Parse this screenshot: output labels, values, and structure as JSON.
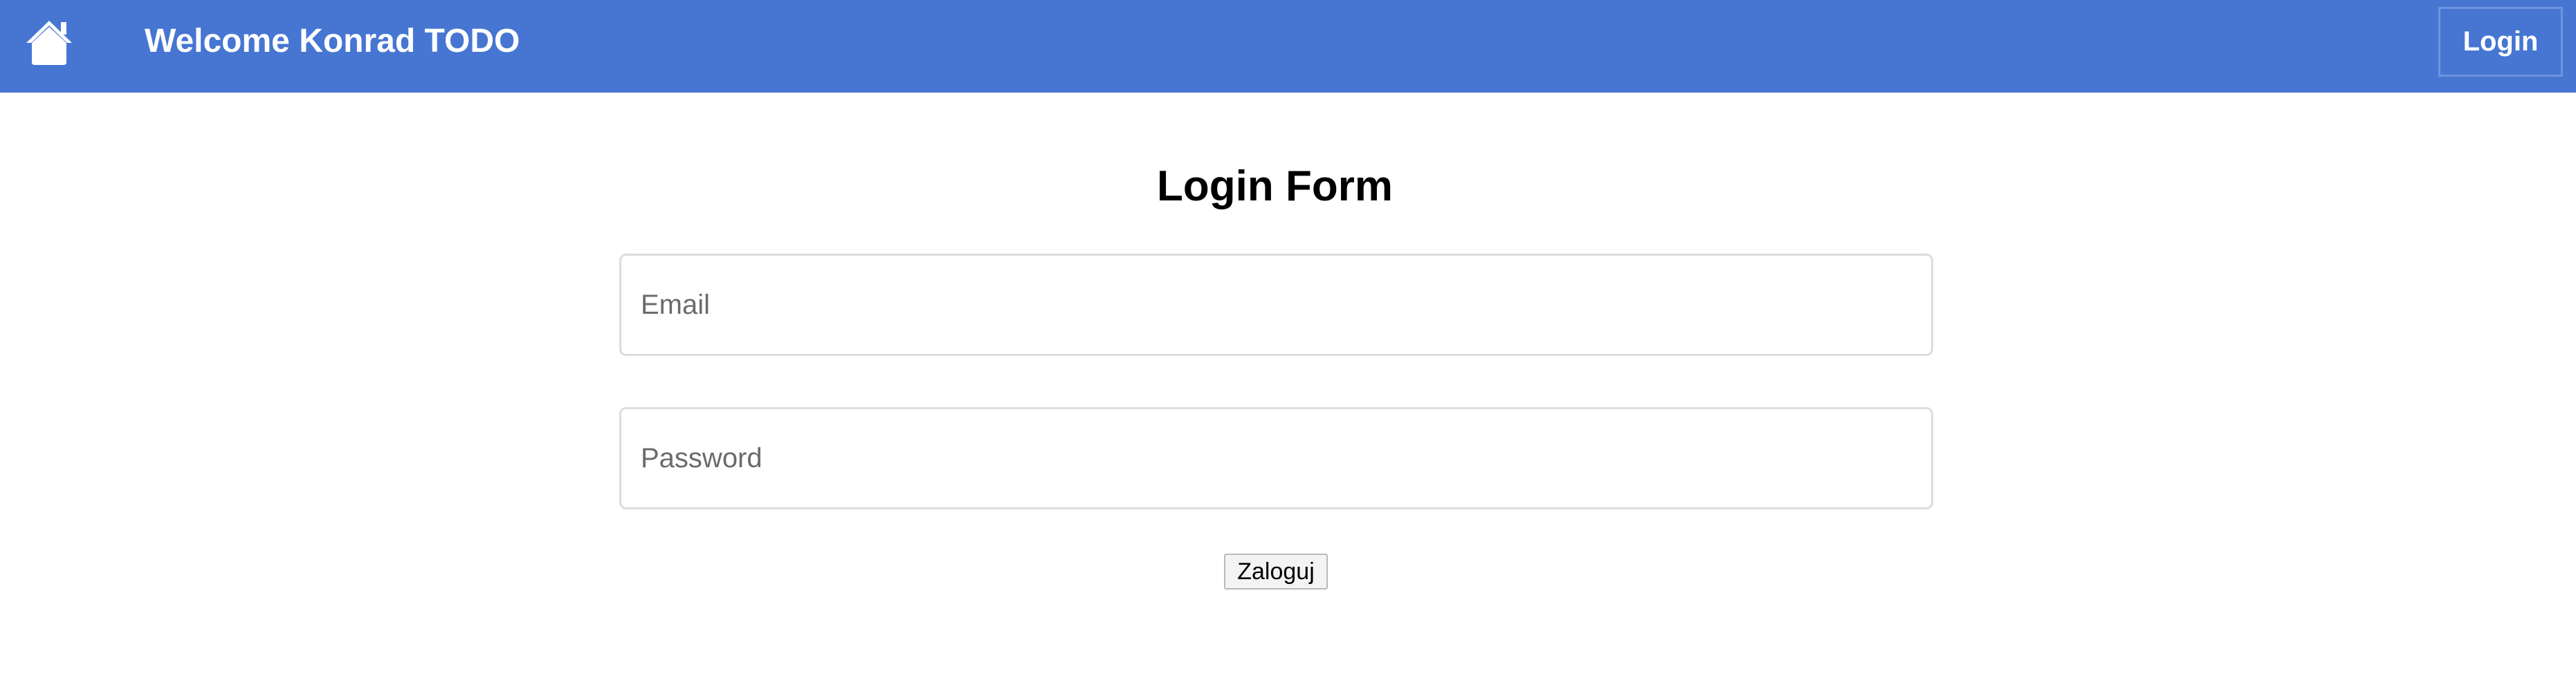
{
  "navbar": {
    "home_icon": "home-icon",
    "brand": "Welcome Konrad TODO",
    "login_label": "Login",
    "background_color": "#4676d2"
  },
  "form": {
    "title": "Login Form",
    "email_placeholder": "Email",
    "password_placeholder": "Password",
    "submit_label": "Zaloguj"
  }
}
